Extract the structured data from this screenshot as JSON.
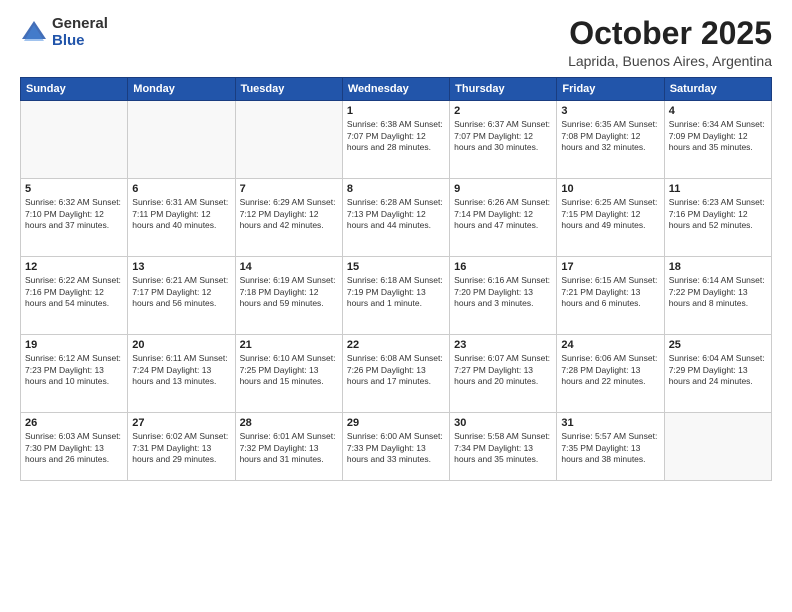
{
  "logo": {
    "general": "General",
    "blue": "Blue"
  },
  "title": "October 2025",
  "subtitle": "Laprida, Buenos Aires, Argentina",
  "weekdays": [
    "Sunday",
    "Monday",
    "Tuesday",
    "Wednesday",
    "Thursday",
    "Friday",
    "Saturday"
  ],
  "weeks": [
    [
      {
        "day": "",
        "info": ""
      },
      {
        "day": "",
        "info": ""
      },
      {
        "day": "",
        "info": ""
      },
      {
        "day": "1",
        "info": "Sunrise: 6:38 AM\nSunset: 7:07 PM\nDaylight: 12 hours\nand 28 minutes."
      },
      {
        "day": "2",
        "info": "Sunrise: 6:37 AM\nSunset: 7:07 PM\nDaylight: 12 hours\nand 30 minutes."
      },
      {
        "day": "3",
        "info": "Sunrise: 6:35 AM\nSunset: 7:08 PM\nDaylight: 12 hours\nand 32 minutes."
      },
      {
        "day": "4",
        "info": "Sunrise: 6:34 AM\nSunset: 7:09 PM\nDaylight: 12 hours\nand 35 minutes."
      }
    ],
    [
      {
        "day": "5",
        "info": "Sunrise: 6:32 AM\nSunset: 7:10 PM\nDaylight: 12 hours\nand 37 minutes."
      },
      {
        "day": "6",
        "info": "Sunrise: 6:31 AM\nSunset: 7:11 PM\nDaylight: 12 hours\nand 40 minutes."
      },
      {
        "day": "7",
        "info": "Sunrise: 6:29 AM\nSunset: 7:12 PM\nDaylight: 12 hours\nand 42 minutes."
      },
      {
        "day": "8",
        "info": "Sunrise: 6:28 AM\nSunset: 7:13 PM\nDaylight: 12 hours\nand 44 minutes."
      },
      {
        "day": "9",
        "info": "Sunrise: 6:26 AM\nSunset: 7:14 PM\nDaylight: 12 hours\nand 47 minutes."
      },
      {
        "day": "10",
        "info": "Sunrise: 6:25 AM\nSunset: 7:15 PM\nDaylight: 12 hours\nand 49 minutes."
      },
      {
        "day": "11",
        "info": "Sunrise: 6:23 AM\nSunset: 7:16 PM\nDaylight: 12 hours\nand 52 minutes."
      }
    ],
    [
      {
        "day": "12",
        "info": "Sunrise: 6:22 AM\nSunset: 7:16 PM\nDaylight: 12 hours\nand 54 minutes."
      },
      {
        "day": "13",
        "info": "Sunrise: 6:21 AM\nSunset: 7:17 PM\nDaylight: 12 hours\nand 56 minutes."
      },
      {
        "day": "14",
        "info": "Sunrise: 6:19 AM\nSunset: 7:18 PM\nDaylight: 12 hours\nand 59 minutes."
      },
      {
        "day": "15",
        "info": "Sunrise: 6:18 AM\nSunset: 7:19 PM\nDaylight: 13 hours\nand 1 minute."
      },
      {
        "day": "16",
        "info": "Sunrise: 6:16 AM\nSunset: 7:20 PM\nDaylight: 13 hours\nand 3 minutes."
      },
      {
        "day": "17",
        "info": "Sunrise: 6:15 AM\nSunset: 7:21 PM\nDaylight: 13 hours\nand 6 minutes."
      },
      {
        "day": "18",
        "info": "Sunrise: 6:14 AM\nSunset: 7:22 PM\nDaylight: 13 hours\nand 8 minutes."
      }
    ],
    [
      {
        "day": "19",
        "info": "Sunrise: 6:12 AM\nSunset: 7:23 PM\nDaylight: 13 hours\nand 10 minutes."
      },
      {
        "day": "20",
        "info": "Sunrise: 6:11 AM\nSunset: 7:24 PM\nDaylight: 13 hours\nand 13 minutes."
      },
      {
        "day": "21",
        "info": "Sunrise: 6:10 AM\nSunset: 7:25 PM\nDaylight: 13 hours\nand 15 minutes."
      },
      {
        "day": "22",
        "info": "Sunrise: 6:08 AM\nSunset: 7:26 PM\nDaylight: 13 hours\nand 17 minutes."
      },
      {
        "day": "23",
        "info": "Sunrise: 6:07 AM\nSunset: 7:27 PM\nDaylight: 13 hours\nand 20 minutes."
      },
      {
        "day": "24",
        "info": "Sunrise: 6:06 AM\nSunset: 7:28 PM\nDaylight: 13 hours\nand 22 minutes."
      },
      {
        "day": "25",
        "info": "Sunrise: 6:04 AM\nSunset: 7:29 PM\nDaylight: 13 hours\nand 24 minutes."
      }
    ],
    [
      {
        "day": "26",
        "info": "Sunrise: 6:03 AM\nSunset: 7:30 PM\nDaylight: 13 hours\nand 26 minutes."
      },
      {
        "day": "27",
        "info": "Sunrise: 6:02 AM\nSunset: 7:31 PM\nDaylight: 13 hours\nand 29 minutes."
      },
      {
        "day": "28",
        "info": "Sunrise: 6:01 AM\nSunset: 7:32 PM\nDaylight: 13 hours\nand 31 minutes."
      },
      {
        "day": "29",
        "info": "Sunrise: 6:00 AM\nSunset: 7:33 PM\nDaylight: 13 hours\nand 33 minutes."
      },
      {
        "day": "30",
        "info": "Sunrise: 5:58 AM\nSunset: 7:34 PM\nDaylight: 13 hours\nand 35 minutes."
      },
      {
        "day": "31",
        "info": "Sunrise: 5:57 AM\nSunset: 7:35 PM\nDaylight: 13 hours\nand 38 minutes."
      },
      {
        "day": "",
        "info": ""
      }
    ]
  ]
}
